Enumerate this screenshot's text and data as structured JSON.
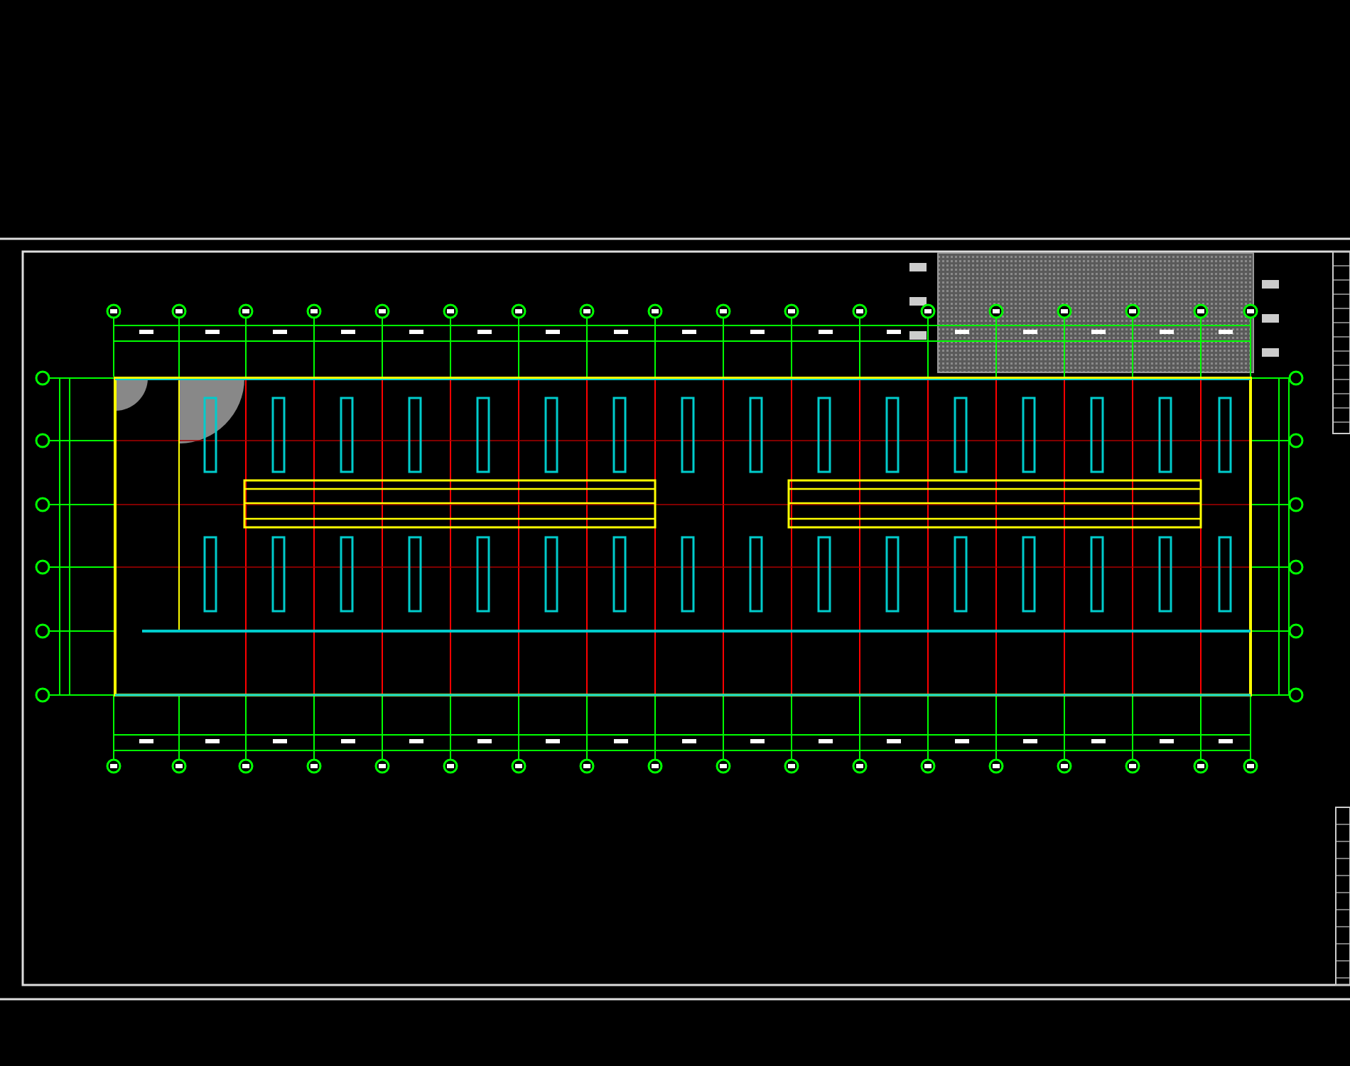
{
  "drawing": {
    "kind": "floor_plan"
  }
}
